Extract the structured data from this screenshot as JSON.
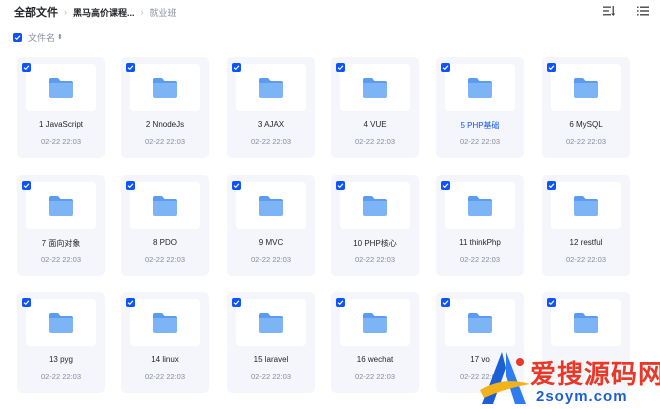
{
  "breadcrumb": {
    "root": "全部文件",
    "middle": "黑马高价课程...",
    "current": "就业班"
  },
  "toolbar": {
    "sort_icon": "sort-icon",
    "list_view_icon": "list-view-icon"
  },
  "sortbar": {
    "label": "文件名",
    "arrow": "⬍"
  },
  "colors": {
    "accent": "#0d53ff",
    "folder": "#7cb4f5",
    "card_bg": "#f4f6fb"
  },
  "folders": [
    {
      "name": "1 JavaScript",
      "time": "02-22 22:03",
      "highlight": false
    },
    {
      "name": "2 NnodeJs",
      "time": "02-22 22:03",
      "highlight": false
    },
    {
      "name": "3 AJAX",
      "time": "02-22 22:03",
      "highlight": false
    },
    {
      "name": "4 VUE",
      "time": "02-22 22:03",
      "highlight": false
    },
    {
      "name": "5 PHP基础",
      "time": "02-22 22:03",
      "highlight": true
    },
    {
      "name": "6 MySQL",
      "time": "02-22 22:03",
      "highlight": false
    },
    {
      "name": "7 面向对象",
      "time": "02-22 22:03",
      "highlight": false
    },
    {
      "name": "8 PDO",
      "time": "02-22 22:03",
      "highlight": false
    },
    {
      "name": "9 MVC",
      "time": "02-22 22:03",
      "highlight": false
    },
    {
      "name": "10 PHP核心",
      "time": "02-22 22:03",
      "highlight": false
    },
    {
      "name": "11 thinkPhp",
      "time": "02-22 22:03",
      "highlight": false
    },
    {
      "name": "12 restful",
      "time": "02-22 22:03",
      "highlight": false
    },
    {
      "name": "13 pyg",
      "time": "02-22 22:03",
      "highlight": false
    },
    {
      "name": "14 linux",
      "time": "02-22 22:03",
      "highlight": false
    },
    {
      "name": "15 laravel",
      "time": "02-22 22:03",
      "highlight": false
    },
    {
      "name": "16 wechat",
      "time": "02-22 22:03",
      "highlight": false
    },
    {
      "name": "17 vo",
      "time": "02-22 22:03",
      "highlight": false
    },
    {
      "name": "",
      "time": "",
      "highlight": false
    }
  ],
  "watermark": {
    "text_cn": "爱搜源码网",
    "text_en": "2soym.com"
  }
}
